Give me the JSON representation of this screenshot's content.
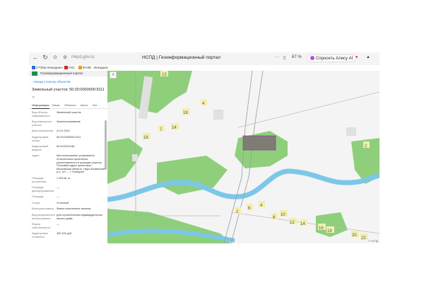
{
  "browser": {
    "url": "mkpd.gov.ru",
    "tab_title": "НСПД | Геоинформационный портал",
    "zoom": "67 %",
    "alice": "Спросить Алису AI",
    "bookmarks": [
      {
        "label": "(77)Мы Инкоднаст",
        "color": "#2f6fde"
      },
      {
        "label": "ГИС",
        "color": "#cc2b2b"
      },
      {
        "label": "ФАЗЕ - Инкоднас",
        "color": "#f29a1f"
      }
    ]
  },
  "panel": {
    "header": "Геоинформационный портал",
    "back_link": "Назад к поиску объектов",
    "title": "Земельный участок: 50:20:0000000:9111",
    "close": "✕",
    "tabs": [
      "Информация",
      "Связи",
      "Объекты",
      "Части",
      "Ист"
    ],
    "active_tab": 0,
    "rows": [
      {
        "k": "Вид объекта недвижимости",
        "v": "Земельный участок"
      },
      {
        "k": "Вид земельного участка",
        "v": "Землепользование"
      },
      {
        "k": "Дата присвоения",
        "v": "01.01.2012"
      },
      {
        "k": "Кадастровый номер",
        "v": "50:20:0000000:9111"
      },
      {
        "k": "Кадастровый квартал",
        "v": "50:20:0010136"
      },
      {
        "k": "Адрес",
        "v": "Местоположение установлено относительно ориентира, расположенного в границах участка. Почтовый адрес ориентира: Московская область, Наро-Фоминский р-н, с/п ..., г. Голицыно"
      },
      {
        "k": "Площадь уточненная",
        "v": "1 200 кв. м"
      },
      {
        "k": "Площадь декларированная",
        "v": "—"
      },
      {
        "k": "Площадь",
        "v": "—"
      },
      {
        "k": "Статус",
        "v": "Учтенный"
      },
      {
        "k": "Категория земель",
        "v": "Земли населенных пунктов"
      },
      {
        "k": "Вид разрешенного использования",
        "v": "Для строительства индивидуального жилого дома"
      },
      {
        "k": "Форма собственности",
        "v": "—"
      },
      {
        "k": "Кадастровая стоимость",
        "v": "460 320 руб."
      }
    ]
  },
  "map": {
    "layer_button": "≡",
    "house_numbers": [
      "13",
      "4",
      "18",
      "14",
      "7",
      "18",
      "2",
      "2",
      "6",
      "4",
      "8",
      "10",
      "12",
      "14",
      "16",
      "18",
      "20",
      "22"
    ],
    "credit": "© НСПД"
  }
}
